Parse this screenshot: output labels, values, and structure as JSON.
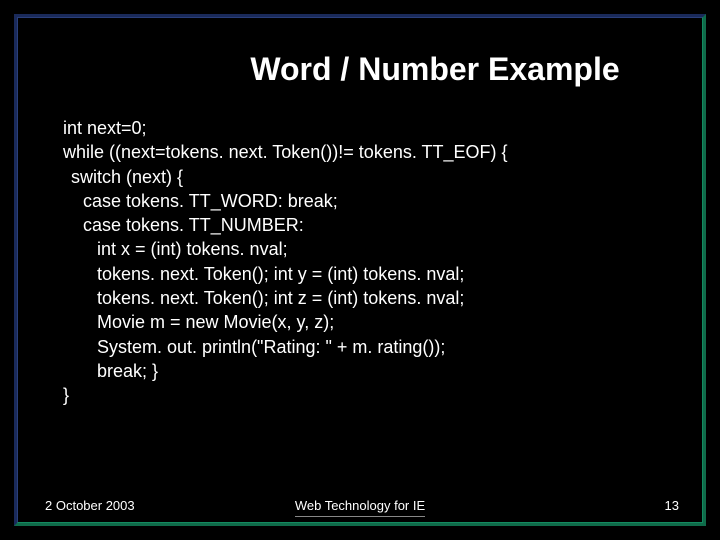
{
  "title": "Word / Number Example",
  "code": {
    "l0": "int next=0;",
    "l1": "while ((next=tokens. next. Token())!= tokens. TT_EOF) {",
    "l2": "switch (next) {",
    "l3": "case tokens. TT_WORD: break;",
    "l4": "case tokens. TT_NUMBER:",
    "l5": "int x = (int) tokens. nval;",
    "l6": "tokens. next. Token(); int y = (int) tokens. nval;",
    "l7": "tokens. next. Token(); int z = (int) tokens. nval;",
    "l8": "Movie m = new Movie(x, y, z);",
    "l9": "System. out. println(\"Rating: \" + m. rating());",
    "l10": "break; }",
    "l11": "}"
  },
  "footer": {
    "date": "2 October 2003",
    "center": "Web Technology for IE",
    "page": "13"
  }
}
